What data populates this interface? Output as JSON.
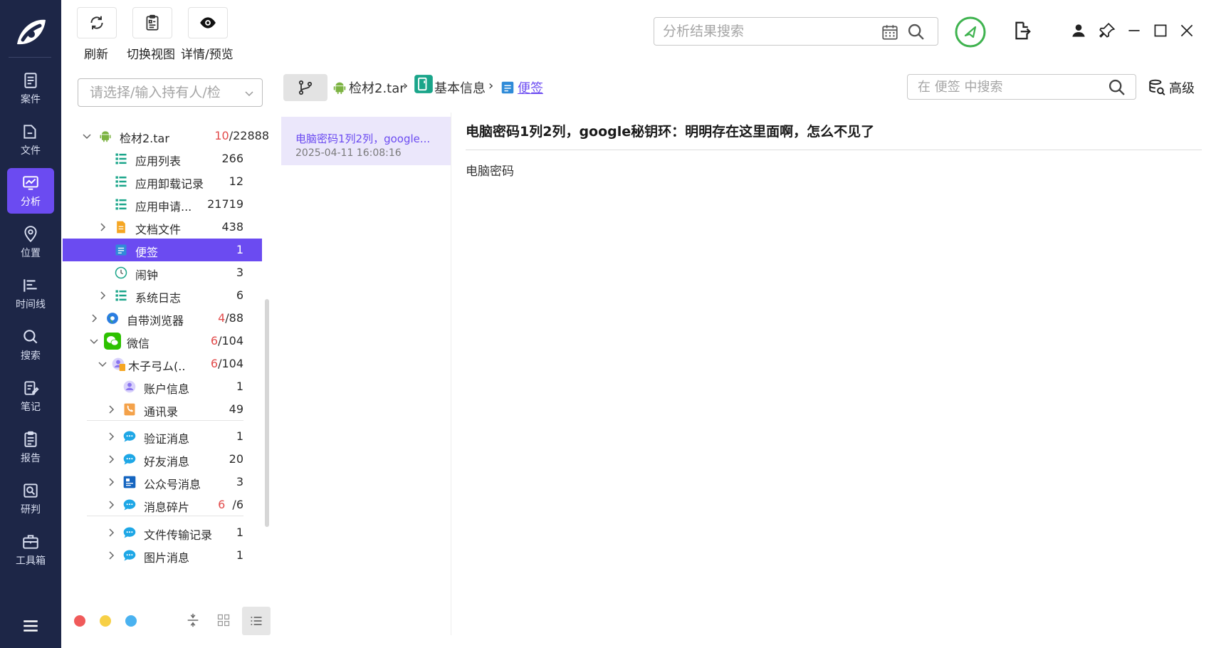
{
  "toolbar": {
    "refresh_label": "刷新",
    "switch_view_label": "切换视图",
    "details_label": "详情/预览"
  },
  "top_search": {
    "placeholder": "分析结果搜索"
  },
  "left_nav": {
    "items": [
      {
        "label": "案件",
        "icon": "case-icon"
      },
      {
        "label": "文件",
        "icon": "folder-icon"
      },
      {
        "label": "分析",
        "icon": "analysis-icon",
        "active": true
      },
      {
        "label": "位置",
        "icon": "location-icon"
      },
      {
        "label": "时间线",
        "icon": "timeline-icon"
      },
      {
        "label": "搜索",
        "icon": "search-icon"
      },
      {
        "label": "笔记",
        "icon": "notes-icon"
      },
      {
        "label": "报告",
        "icon": "report-icon"
      },
      {
        "label": "研判",
        "icon": "judge-icon"
      },
      {
        "label": "工具箱",
        "icon": "toolbox-icon"
      }
    ]
  },
  "owner_select": {
    "placeholder": "请选择/输入持有人/检"
  },
  "tree": {
    "root": {
      "label": "检材2.tar",
      "count_red": "10",
      "count_total": "/22888"
    },
    "app_list": {
      "label": "应用列表",
      "count": "266"
    },
    "app_uninstall": {
      "label": "应用卸载记录",
      "count": "12"
    },
    "app_request": {
      "label": "应用申请...",
      "count": "21719"
    },
    "documents": {
      "label": "文档文件",
      "count": "438"
    },
    "notes": {
      "label": "便签",
      "count": "1"
    },
    "alarm": {
      "label": "闹钟",
      "count": "3"
    },
    "syslog": {
      "label": "系统日志",
      "count": "6"
    },
    "browser": {
      "label": "自带浏览器",
      "count_red": "4",
      "count_total": "/88"
    },
    "wechat": {
      "label": "微信",
      "count_red": "6",
      "count_total": "/104"
    },
    "wechat_account": {
      "label": "木子弓ム(...",
      "count_red": "6",
      "count_total": "/104"
    },
    "account_info": {
      "label": "账户信息",
      "count": "1"
    },
    "contacts": {
      "label": "通讯录",
      "count": "49"
    },
    "verify_msg": {
      "label": "验证消息",
      "count": "1"
    },
    "friend_msg": {
      "label": "好友消息",
      "count": "20"
    },
    "public_msg": {
      "label": "公众号消息",
      "count": "3"
    },
    "msg_fragments": {
      "label": "消息碎片",
      "count_red": "6",
      "count_total": "/6"
    },
    "file_transfer": {
      "label": "文件传输记录",
      "count": "1"
    },
    "image_msg": {
      "label": "图片消息",
      "count": "1"
    }
  },
  "breadcrumb": {
    "items": [
      "检材2.tar",
      "基本信息",
      "便签"
    ]
  },
  "content_search": {
    "placeholder": "在 便签 中搜索"
  },
  "advanced_label": "高级",
  "list": {
    "items": [
      {
        "title": "电脑密码1列2列，google...",
        "date": "2025-04-11 16:08:16"
      }
    ]
  },
  "detail": {
    "title": "电脑密码1列2列，google秘钥环：明明存在这里面啊，怎么不见了",
    "body": "电脑密码"
  },
  "colors": {
    "nav_bg": "#1d2647",
    "accent": "#6b4bf1",
    "count_red": "#e24b4b",
    "status_green": "#3fb34f"
  }
}
